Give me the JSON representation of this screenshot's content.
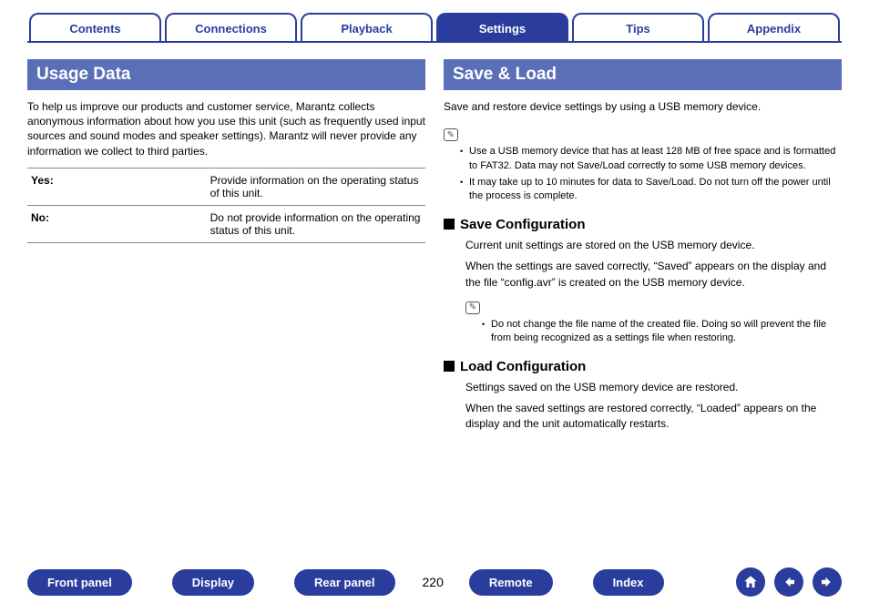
{
  "tabs": [
    "Contents",
    "Connections",
    "Playback",
    "Settings",
    "Tips",
    "Appendix"
  ],
  "activeTab": 3,
  "left": {
    "title": "Usage Data",
    "intro": "To help us improve our products and customer service, Marantz collects anonymous information about how you use this unit (such as frequently used input sources and sound modes and speaker settings). Marantz will never provide any information we collect to third parties.",
    "rows": [
      {
        "k": "Yes:",
        "v": "Provide information on the operating status of this unit."
      },
      {
        "k": "No:",
        "v": "Do not provide information on the operating status of this unit."
      }
    ]
  },
  "right": {
    "title": "Save & Load",
    "intro": "Save and restore device settings by using a USB memory device.",
    "notes1": [
      "Use a USB memory device that has at least 128 MB of free space and is formatted to FAT32. Data may not Save/Load correctly to some USB memory devices.",
      "It may take up to 10 minutes for data to Save/Load. Do not turn off the power until the process is complete."
    ],
    "save": {
      "heading": "Save Configuration",
      "p1": "Current unit settings are stored on the USB memory device.",
      "p2": "When the settings are saved correctly, “Saved” appears on the display and the file “config.avr” is created on the USB memory device.",
      "note": "Do not change the file name of the created file. Doing so will prevent the file from being recognized as a settings file when restoring."
    },
    "load": {
      "heading": "Load Configuration",
      "p1": "Settings saved on the USB memory device are restored.",
      "p2": "When the saved settings are restored correctly, “Loaded” appears on the display and the unit automatically restarts."
    }
  },
  "footer": {
    "buttons": [
      "Front panel",
      "Display",
      "Rear panel"
    ],
    "page": "220",
    "buttons2": [
      "Remote",
      "Index"
    ]
  }
}
